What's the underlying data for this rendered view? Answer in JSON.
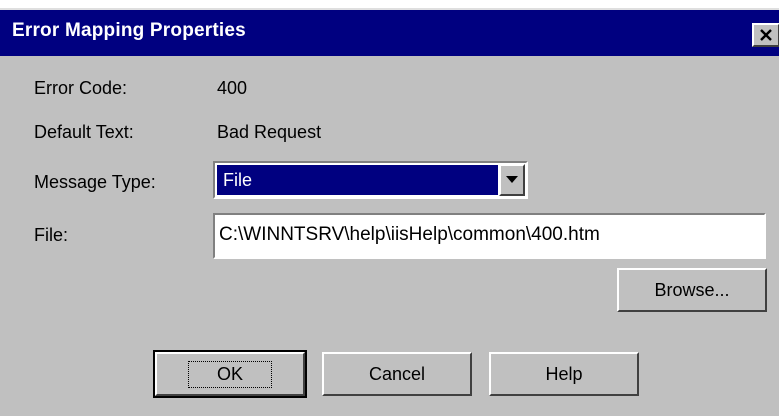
{
  "window": {
    "title": "Error Mapping Properties",
    "close_glyph": "✕"
  },
  "fields": {
    "error_code_label": "Error Code:",
    "error_code_value": "400",
    "default_text_label": "Default Text:",
    "default_text_value": "Bad Request",
    "message_type_label": "Message Type:",
    "message_type_value": "File",
    "file_label": "File:",
    "file_value": "C:\\WINNTSRV\\help\\iisHelp\\common\\400.htm"
  },
  "buttons": {
    "browse": "Browse...",
    "ok": "OK",
    "cancel": "Cancel",
    "help": "Help"
  },
  "colors": {
    "titlebar": "#000080",
    "face": "#c0c0c0",
    "selection": "#000080"
  }
}
